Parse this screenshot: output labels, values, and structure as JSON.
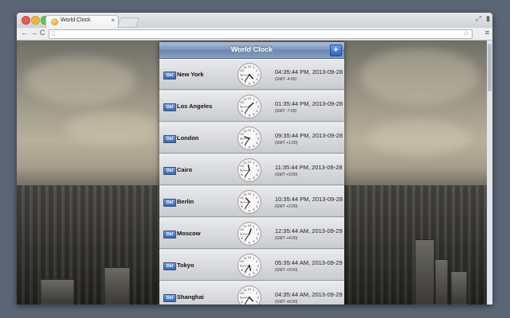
{
  "browser": {
    "tab_title": "World Clock",
    "tab_close": "×",
    "url": "",
    "back_icon": "←",
    "forward_icon": "→",
    "reload_icon": "C",
    "star_icon": "☆",
    "menu_icon": "≡"
  },
  "app": {
    "title": "World Clock",
    "add_label": "+",
    "delete_label": "Del",
    "accent_color": "#6a85ab",
    "clocks": [
      {
        "city": "New York",
        "time": "04:35:44 PM, 2013-09-28",
        "gmt": "(GMT -4:00)",
        "hour": 16,
        "minute": 35,
        "second": 44
      },
      {
        "city": "Los Angeles",
        "time": "01:35:44 PM, 2013-09-28",
        "gmt": "(GMT -7:00)",
        "hour": 13,
        "minute": 35,
        "second": 44
      },
      {
        "city": "London",
        "time": "09:35:44 PM, 2013-09-28",
        "gmt": "(GMT +1:00)",
        "hour": 21,
        "minute": 35,
        "second": 44
      },
      {
        "city": "Cairo",
        "time": "11:35:44 PM, 2013-09-28",
        "gmt": "(GMT +3:00)",
        "hour": 23,
        "minute": 35,
        "second": 44
      },
      {
        "city": "Berlin",
        "time": "10:35:44 PM, 2013-09-28",
        "gmt": "(GMT +2:00)",
        "hour": 22,
        "minute": 35,
        "second": 44
      },
      {
        "city": "Moscow",
        "time": "12:35:44 AM, 2013-09-29",
        "gmt": "(GMT +4:00)",
        "hour": 0,
        "minute": 35,
        "second": 44
      },
      {
        "city": "Tokyo",
        "time": "05:35:44 AM, 2013-09-29",
        "gmt": "(GMT +9:00)",
        "hour": 5,
        "minute": 35,
        "second": 44
      },
      {
        "city": "Shanghai",
        "time": "04:35:44 AM, 2013-09-29",
        "gmt": "(GMT +8:00)",
        "hour": 4,
        "minute": 35,
        "second": 44
      }
    ]
  }
}
